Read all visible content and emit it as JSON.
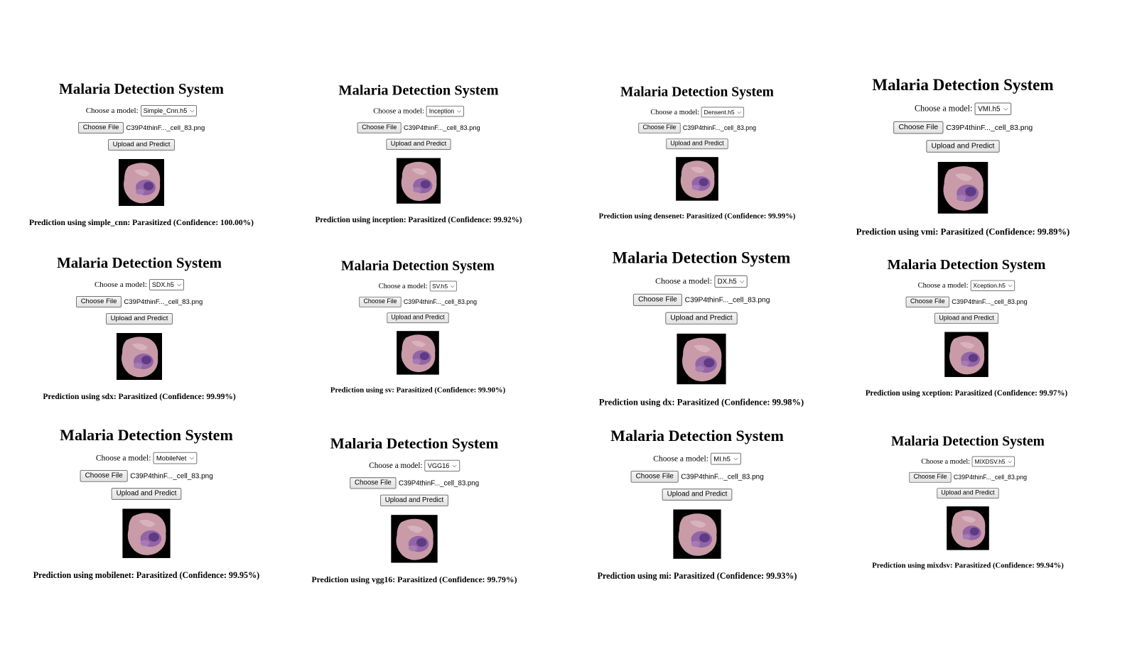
{
  "panels": [
    {
      "title": "Malaria Detection System",
      "model_label": "Choose a model:",
      "model": "Simple_Cnn.h5",
      "choose_label": "Choose File",
      "file": "C39P4thinF..._cell_83.png",
      "upload_label": "Upload and Predict",
      "result": "Prediction using simple_cnn: Parasitized (Confidence: 100.00%)"
    },
    {
      "title": "Malaria Detection System",
      "model_label": "Choose a model:",
      "model": "Inception",
      "choose_label": "Choose File",
      "file": "C39P4thinF..._cell_83.png",
      "upload_label": "Upload and Predict",
      "result": "Prediction using inception: Parasitized (Confidence: 99.92%)"
    },
    {
      "title": "Malaria Detection System",
      "model_label": "Choose a model:",
      "model": "Densent.h5",
      "choose_label": "Choose File",
      "file": "C39P4thinF..._cell_83.png",
      "upload_label": "Upload and Predict",
      "result": "Prediction using densenet: Parasitized (Confidence: 99.99%)"
    },
    {
      "title": "Malaria Detection System",
      "model_label": "Choose a model:",
      "model": "VMI.h5",
      "choose_label": "Choose File",
      "file": "C39P4thinF..._cell_83.png",
      "upload_label": "Upload and Predict",
      "result": "Prediction using vmi: Parasitized (Confidence: 99.89%)"
    },
    {
      "title": "Malaria Detection System",
      "model_label": "Choose a model:",
      "model": "SDX.h5",
      "choose_label": "Choose File",
      "file": "C39P4thinF..._cell_83.png",
      "upload_label": "Upload and Predict",
      "result": "Prediction using sdx: Parasitized (Confidence: 99.99%)"
    },
    {
      "title": "Malaria Detection System",
      "model_label": "Choose a model:",
      "model": "SV.h5",
      "choose_label": "Choose File",
      "file": "C39P4thinF..._cell_83.png",
      "upload_label": "Upload and Predict",
      "result": "Prediction using sv: Parasitized (Confidence: 99.90%)"
    },
    {
      "title": "Malaria Detection System",
      "model_label": "Choose a model:",
      "model": "DX.h5",
      "choose_label": "Choose File",
      "file": "C39P4thinF..._cell_83.png",
      "upload_label": "Upload and Predict",
      "result": "Prediction using dx: Parasitized (Confidence: 99.98%)"
    },
    {
      "title": "Malaria Detection System",
      "model_label": "Choose a model:",
      "model": "Xception.h5",
      "choose_label": "Choose File",
      "file": "C39P4thinF..._cell_83.png",
      "upload_label": "Upload and Predict",
      "result": "Prediction using xception: Parasitized (Confidence: 99.97%)"
    },
    {
      "title": "Malaria Detection System",
      "model_label": "Choose a model:",
      "model": "MobileNet",
      "choose_label": "Choose File",
      "file": "C39P4thinF..._cell_83.png",
      "upload_label": "Upload and Predict",
      "result": "Prediction using mobilenet: Parasitized (Confidence: 99.95%)"
    },
    {
      "title": "Malaria Detection System",
      "model_label": "Choose a model:",
      "model": "VGG16",
      "choose_label": "Choose File",
      "file": "C39P4thinF..._cell_83.png",
      "upload_label": "Upload and Predict",
      "result": "Prediction using vgg16: Parasitized (Confidence: 99.79%)"
    },
    {
      "title": "Malaria Detection System",
      "model_label": "Choose a model:",
      "model": "MI.h5",
      "choose_label": "Choose File",
      "file": "C39P4thinF..._cell_83.png",
      "upload_label": "Upload and Predict",
      "result": "Prediction using mi: Parasitized (Confidence: 99.93%)"
    },
    {
      "title": "Malaria Detection System",
      "model_label": "Choose a model:",
      "model": "MIXDSV.h5",
      "choose_label": "Choose File",
      "file": "C39P4thinF..._cell_83.png",
      "upload_label": "Upload and Predict",
      "result": "Prediction using mixdsv: Parasitized (Confidence: 99.94%)"
    }
  ],
  "colors": {
    "cell_pink": "#c99aa8",
    "cell_purple": "#7a4a9a",
    "background": "#ffffff"
  }
}
